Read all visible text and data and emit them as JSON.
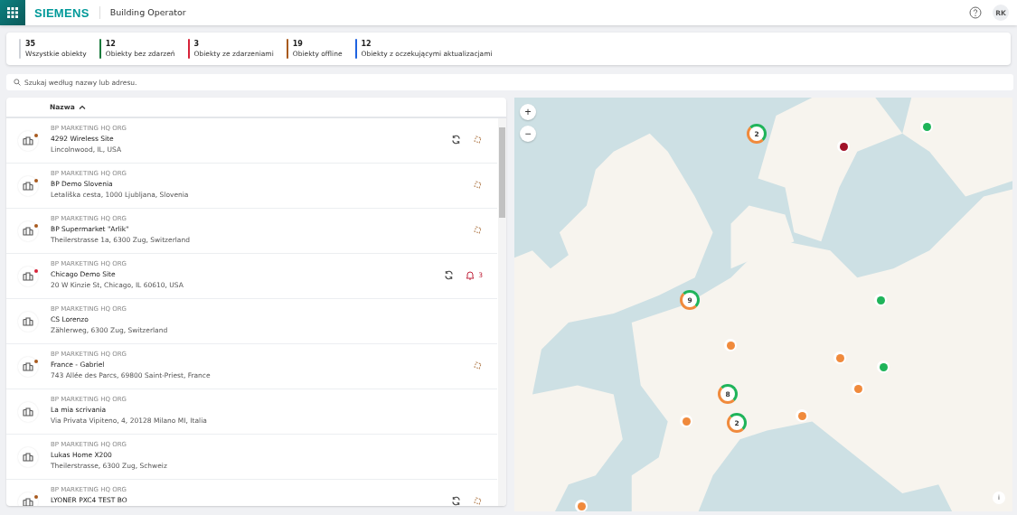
{
  "header": {
    "logo": "SIEMENS",
    "app_title": "Building Operator",
    "avatar": "RK"
  },
  "stats": [
    {
      "count": "35",
      "label": "Wszystkie obiekty",
      "color": "#d0d3d8"
    },
    {
      "count": "12",
      "label": "Obiekty bez zdarzeń",
      "color": "#1a7a3c"
    },
    {
      "count": "3",
      "label": "Obiekty ze zdarzeniami",
      "color": "#d72339"
    },
    {
      "count": "19",
      "label": "Obiekty offline",
      "color": "#a85a1e"
    },
    {
      "count": "12",
      "label": "Obiekty z oczekującymi aktualizacjami",
      "color": "#1e62e0"
    }
  ],
  "search": {
    "placeholder": "Szukaj według nazwy lub adresu."
  },
  "list": {
    "column": "Nazwa",
    "rows": [
      {
        "org": "BP MARKETING HQ ORG",
        "name": "4292 Wireless Site",
        "address": "Lincolnwood, IL, USA",
        "color": "#a85a1e",
        "sync": true,
        "offline": true
      },
      {
        "org": "BP MARKETING HQ ORG",
        "name": "BP Demo Slovenia",
        "address": "Letališka cesta, 1000 Ljubljana, Slovenia",
        "color": "#a85a1e",
        "sync": false,
        "offline": true
      },
      {
        "org": "BP MARKETING HQ ORG",
        "name": "BP Supermarket \"Arlik\"",
        "address": "Theilerstrasse 1a, 6300 Zug, Switzerland",
        "color": "#a85a1e",
        "sync": false,
        "offline": true
      },
      {
        "org": "BP MARKETING HQ ORG",
        "name": "Chicago Demo Site",
        "address": "20 W Kinzie St, Chicago, IL 60610, USA",
        "color": "#d72339",
        "sync": true,
        "offline": false,
        "alarms": "3"
      },
      {
        "org": "BP MARKETING HQ ORG",
        "name": "CS Lorenzo",
        "address": "Zählerweg, 6300 Zug, Switzerland",
        "sync": false,
        "offline": false
      },
      {
        "org": "BP MARKETING HQ ORG",
        "name": "France - Gabriel",
        "address": "743 Allée des Parcs, 69800 Saint-Priest, France",
        "color": "#a85a1e",
        "sync": false,
        "offline": true
      },
      {
        "org": "BP MARKETING HQ ORG",
        "name": "La mia scrivania",
        "address": "Via Privata Vipiteno, 4, 20128 Milano MI, Italia",
        "sync": false,
        "offline": false
      },
      {
        "org": "BP MARKETING HQ ORG",
        "name": "Lukas Home X200",
        "address": "Theilerstrasse, 6300 Zug, Schweiz",
        "sync": false,
        "offline": false
      },
      {
        "org": "BP MARKETING HQ ORG",
        "name": "LYONER PXC4 TEST BO",
        "color": "#a85a1e",
        "sync": true,
        "offline": true
      }
    ]
  },
  "map": {
    "zoom_in": "+",
    "zoom_out": "−",
    "info": "i",
    "clusters": [
      {
        "count": "2"
      },
      {
        "count": "9"
      },
      {
        "count": "8"
      },
      {
        "count": "2"
      }
    ],
    "markers": [
      {
        "color": "#1fb45a"
      },
      {
        "color": "#a1122a"
      },
      {
        "color": "#1fb45a"
      },
      {
        "color": "#f08a3c"
      },
      {
        "color": "#f08a3c"
      },
      {
        "color": "#1fb45a"
      },
      {
        "color": "#f08a3c"
      },
      {
        "color": "#f08a3c"
      },
      {
        "color": "#f08a3c"
      },
      {
        "color": "#f08a3c"
      }
    ]
  }
}
